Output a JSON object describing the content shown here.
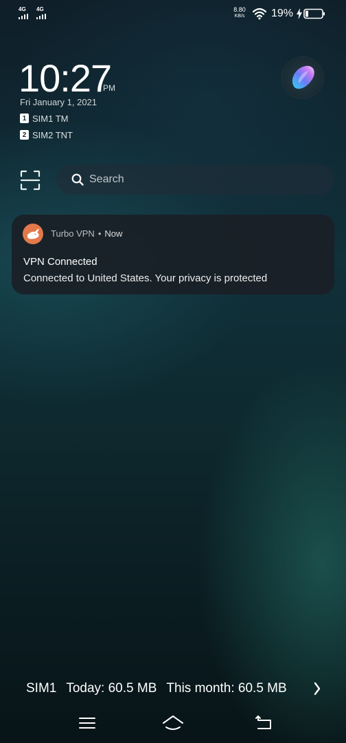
{
  "status_bar": {
    "sim1_network": "4G",
    "sim2_network": "4G",
    "net_speed_value": "8.80",
    "net_speed_unit": "KB/s",
    "battery_percent": "19%",
    "charging": true
  },
  "lockscreen": {
    "time": "10:27",
    "ampm": "PM",
    "date": "Fri January 1, 2021",
    "sims": [
      {
        "slot": "1",
        "label": "SIM1 TM"
      },
      {
        "slot": "2",
        "label": "SIM2 TNT"
      }
    ]
  },
  "search": {
    "placeholder": "Search"
  },
  "notification": {
    "app_name": "Turbo VPN",
    "separator": "•",
    "time": "Now",
    "title": "VPN Connected",
    "body": "Connected to United States. Your privacy is protected",
    "accent_color": "#e3794a"
  },
  "data_usage": {
    "sim": "SIM1",
    "today": "Today: 60.5 MB",
    "month": "This month: 60.5 MB"
  },
  "icons": {
    "wifi": "wifi-icon",
    "charge": "lightning-icon",
    "battery": "battery-icon",
    "scan": "scan-icon",
    "search": "search-icon",
    "assistant": "assistant-orb-icon",
    "menu": "menu-icon",
    "home": "home-icon",
    "back": "back-icon"
  }
}
